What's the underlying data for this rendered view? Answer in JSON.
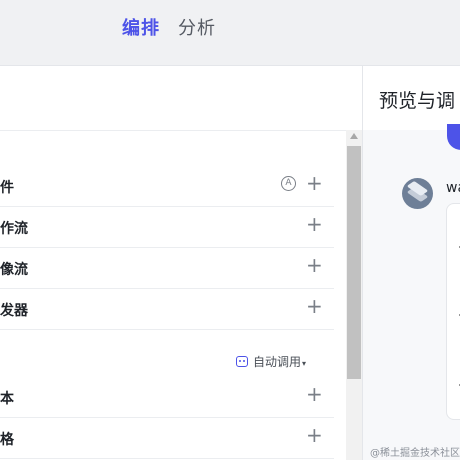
{
  "topbar": {
    "tab_active": "编排",
    "tab_inactive": "分析"
  },
  "left_panel": {
    "header_icon": "grid-icon",
    "rows": [
      {
        "label": "件",
        "badge": "Ⓐ",
        "action": "+"
      },
      {
        "label": "作流",
        "action": "+"
      },
      {
        "label": "像流",
        "action": "+"
      },
      {
        "label": "发器",
        "action": "+"
      }
    ],
    "auto_call": {
      "icon": "bot-icon",
      "label": "自动调用",
      "caret": "▾"
    },
    "rows2": [
      {
        "label": "本",
        "action": "+"
      },
      {
        "label": "格",
        "action": "+"
      }
    ]
  },
  "right_panel": {
    "title": "预览与调",
    "message_name": "wa",
    "check": "✓"
  },
  "watermark": "@稀土掘金技术社区",
  "colors": {
    "accent": "#4d53e8"
  }
}
